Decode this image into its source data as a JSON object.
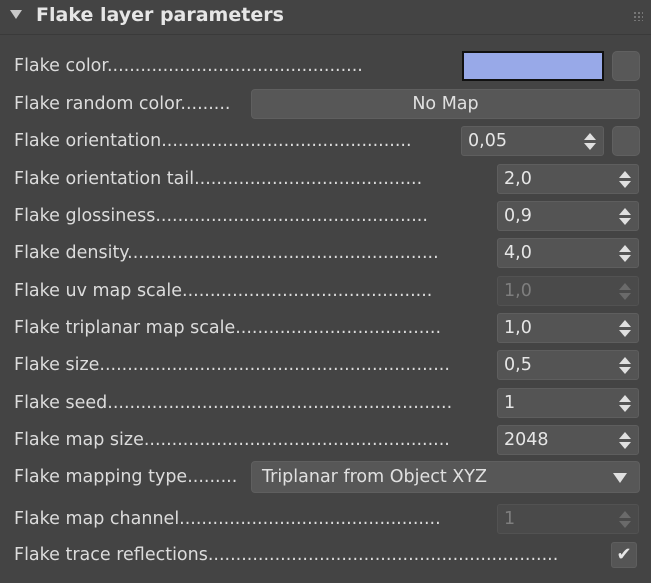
{
  "rollout": {
    "title": "Flake layer parameters"
  },
  "rows": {
    "flake_color": {
      "label": "Flake color..............................................",
      "color": "#98a9e8"
    },
    "flake_random_color": {
      "label": "Flake random color.........",
      "button": "No Map"
    },
    "flake_orientation": {
      "label": "Flake orientation.............................................",
      "value": "0,05"
    },
    "flake_orientation_tail": {
      "label": "Flake orientation tail.........................................",
      "value": "2,0"
    },
    "flake_glossiness": {
      "label": "Flake glossiness.................................................",
      "value": "0,9"
    },
    "flake_density": {
      "label": "Flake density........................................................",
      "value": "4,0"
    },
    "flake_uv_map_scale": {
      "label": "Flake uv map scale.............................................",
      "value": "1,0"
    },
    "flake_triplanar_map_scale": {
      "label": "Flake triplanar map scale.....................................",
      "value": "1,0"
    },
    "flake_size": {
      "label": "Flake size...............................................................",
      "value": "0,5"
    },
    "flake_seed": {
      "label": "Flake seed..............................................................",
      "value": "1"
    },
    "flake_map_size": {
      "label": "Flake map size.......................................................",
      "value": "2048"
    },
    "flake_mapping_type": {
      "label": "Flake mapping type.........",
      "value": "Triplanar from Object XYZ"
    },
    "flake_map_channel": {
      "label": "Flake map channel...............................................",
      "value": "1"
    },
    "flake_trace_reflections": {
      "label": "Flake trace reflections...............................................................",
      "checked": "✔"
    }
  }
}
